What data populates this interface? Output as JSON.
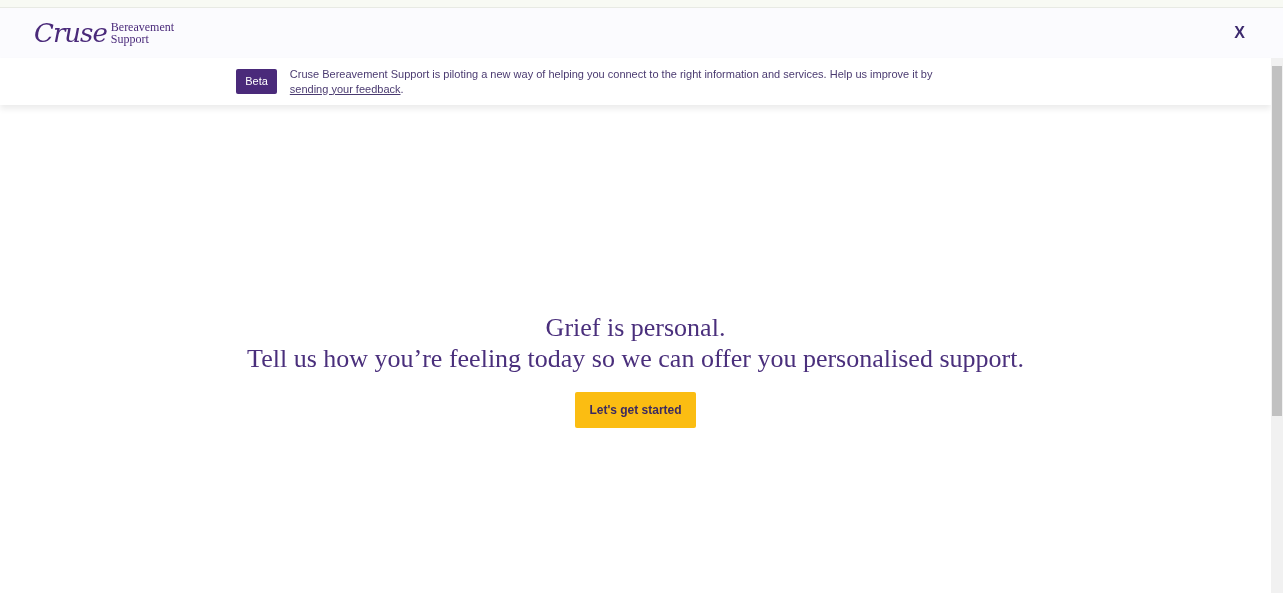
{
  "header": {
    "logo_wordmark": "Cruse",
    "logo_subtitle_1": "Bereavement",
    "logo_subtitle_2": "Support",
    "close": "X"
  },
  "banner": {
    "badge": "Beta",
    "text_before": "Cruse Bereavement Support is piloting a new way of helping you connect to the right information and services. Help us improve it by ",
    "link": "sending your feedback",
    "text_after": "."
  },
  "main": {
    "headline": "Grief is personal.",
    "subheadline": "Tell us how you’re feeling today so we can offer you personalised support.",
    "button": "Let's get started"
  }
}
